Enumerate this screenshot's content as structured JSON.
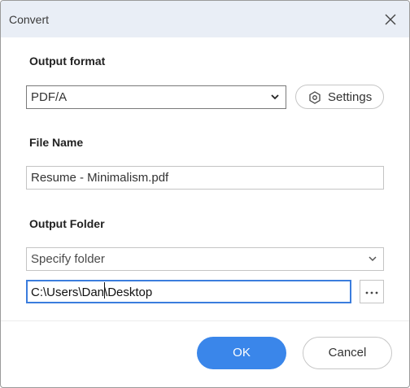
{
  "dialog": {
    "title": "Convert",
    "close_icon": "close-icon"
  },
  "output_format": {
    "label": "Output format",
    "selected": "PDF/A",
    "dropdown_icon": "chevron-down-icon",
    "settings_label": "Settings",
    "settings_icon": "hexagon-gear-icon"
  },
  "file_name": {
    "label": "File Name",
    "value": "Resume - Minimalism.pdf"
  },
  "output_folder": {
    "label": "Output Folder",
    "selected": "Specify folder",
    "dropdown_icon": "chevron-down-icon",
    "path_before_caret": "C:\\Users\\Dan",
    "path_after_caret": "\\Desktop",
    "browse_icon": "ellipsis-icon"
  },
  "footer": {
    "ok_label": "OK",
    "cancel_label": "Cancel"
  },
  "colors": {
    "title_bar": "#e9eef6",
    "primary": "#3a86ea",
    "focus_border": "#3b7ddd"
  }
}
